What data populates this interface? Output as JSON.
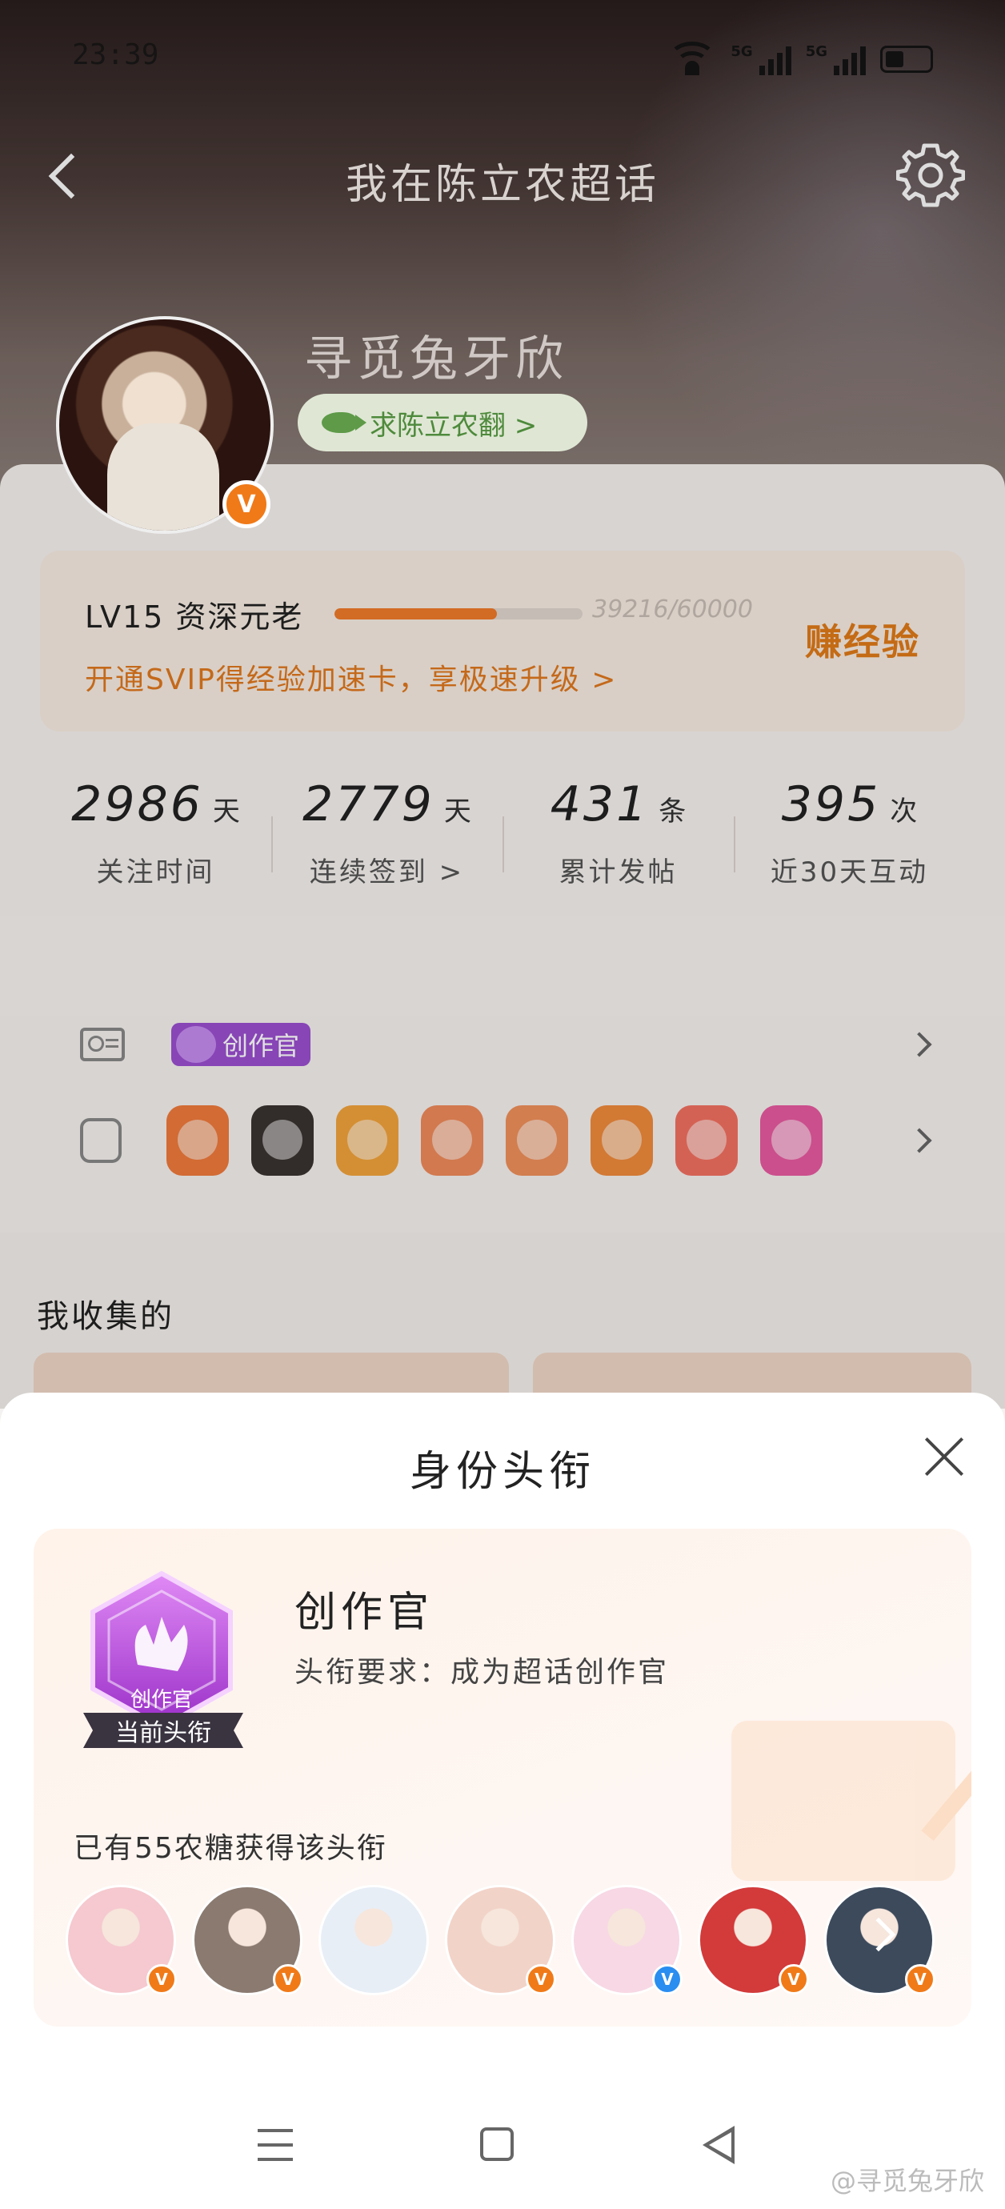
{
  "status_bar": {
    "time": "23:39",
    "network_1": "5G",
    "network_2": "5G"
  },
  "header": {
    "title": "我在陈立农超话"
  },
  "profile": {
    "username": "寻觅兔牙欣",
    "follow_chip": "求陈立农翻 >",
    "verified_mark": "V"
  },
  "level": {
    "label": "LV15 资深元老",
    "progress_current": 39216,
    "progress_total": 60000,
    "progress_text": "39216/60000",
    "promo": "开通SVIP得经验加速卡，享极速升级 >",
    "earn_label": "赚经验"
  },
  "stats": [
    {
      "num": "2986",
      "unit": "天",
      "label": "关注时间"
    },
    {
      "num": "2779",
      "unit": "天",
      "label": "连续签到 >"
    },
    {
      "num": "431",
      "unit": "条",
      "label": "累计发帖"
    },
    {
      "num": "395",
      "unit": "次",
      "label": "近30天互动"
    }
  ],
  "identity_row": {
    "chip": "创作官"
  },
  "medals": {
    "icon": "medal-icon",
    "colors": [
      "#f07a3c",
      "#3a3330",
      "#f2a33c",
      "#f08a5a",
      "#f0905a",
      "#f08a3c",
      "#f27060",
      "#e85aa0"
    ]
  },
  "collect": {
    "title": "我收集的"
  },
  "sheet": {
    "title": "身份头衔",
    "badge_caption": "创作官",
    "badge_ribbon": "当前头衔",
    "title_name": "创作官",
    "title_requirement": "头衔要求：成为超话创作官",
    "owners_text": "已有55农糖获得该头衔",
    "owner_badges": [
      "orange",
      "orange",
      "none",
      "orange",
      "blue",
      "orange",
      "orange"
    ],
    "owner_colors": [
      "#f5c9cf",
      "#8a7a70",
      "#e8eef6",
      "#f2d3c8",
      "#f7d8e4",
      "#d33a3a",
      "#3c4a5c"
    ]
  },
  "nav": {
    "menu_icon": "menu-icon",
    "home_icon": "home-icon",
    "back_icon": "back-triangle-icon"
  },
  "watermark": "@寻觅兔牙欣"
}
